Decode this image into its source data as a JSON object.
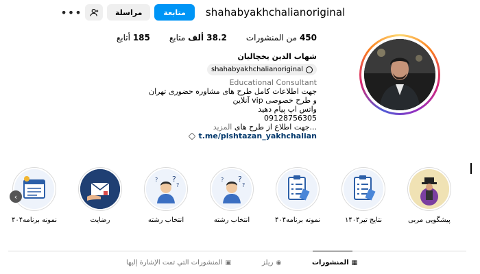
{
  "profile": {
    "username": "shahabyakhchalianoriginal",
    "follow_label": "متابعة",
    "message_label": "مراسلة",
    "more_label": "•••"
  },
  "stats": {
    "posts": {
      "value": "450",
      "label": "من المنشورات"
    },
    "followers": {
      "value": "38.2 ألف",
      "label": "متابع"
    },
    "following": {
      "value": "185",
      "label": "أتابع"
    }
  },
  "bio": {
    "name": "شهاب الدين يخچاليان",
    "threads_handle": "shahabyakhchalianoriginal",
    "category": "Educational Consultant",
    "lines": [
      "جهت اطلاعات کامل طرح های مشاوره حضوری تهران",
      "و طرح خصوصی vip آنلاین",
      "واتس اپ پیام دهید",
      "09128756305"
    ],
    "teaser": "...جهت اطلاع از طرح های",
    "more_label": "المزيد",
    "link": "t.me/pishtazan_yakhchalian"
  },
  "highlights": [
    {
      "label": "پیشگویی مربی",
      "icon": "fortune-teller-icon"
    },
    {
      "label": "نتایج تیر۱۴۰۴",
      "icon": "clipboard-icon"
    },
    {
      "label": "نمونه برنامه۴۰۴",
      "icon": "clipboard-icon"
    },
    {
      "label": "انتخاب رشته",
      "icon": "confused-person-icon"
    },
    {
      "label": "انتخاب رشته",
      "icon": "confused-person-icon"
    },
    {
      "label": "رضایت",
      "icon": "envelope-hand-icon"
    },
    {
      "label": "نمونه برنامه۴۰۴",
      "icon": "planner-icon"
    }
  ],
  "tabs": {
    "posts": "المنشورات",
    "reels": "ريلز",
    "tagged": "المنشورات التي تمت الإشارة إليها"
  },
  "colors": {
    "accent": "#0095f6",
    "link": "#00376b",
    "muted": "#737373"
  }
}
